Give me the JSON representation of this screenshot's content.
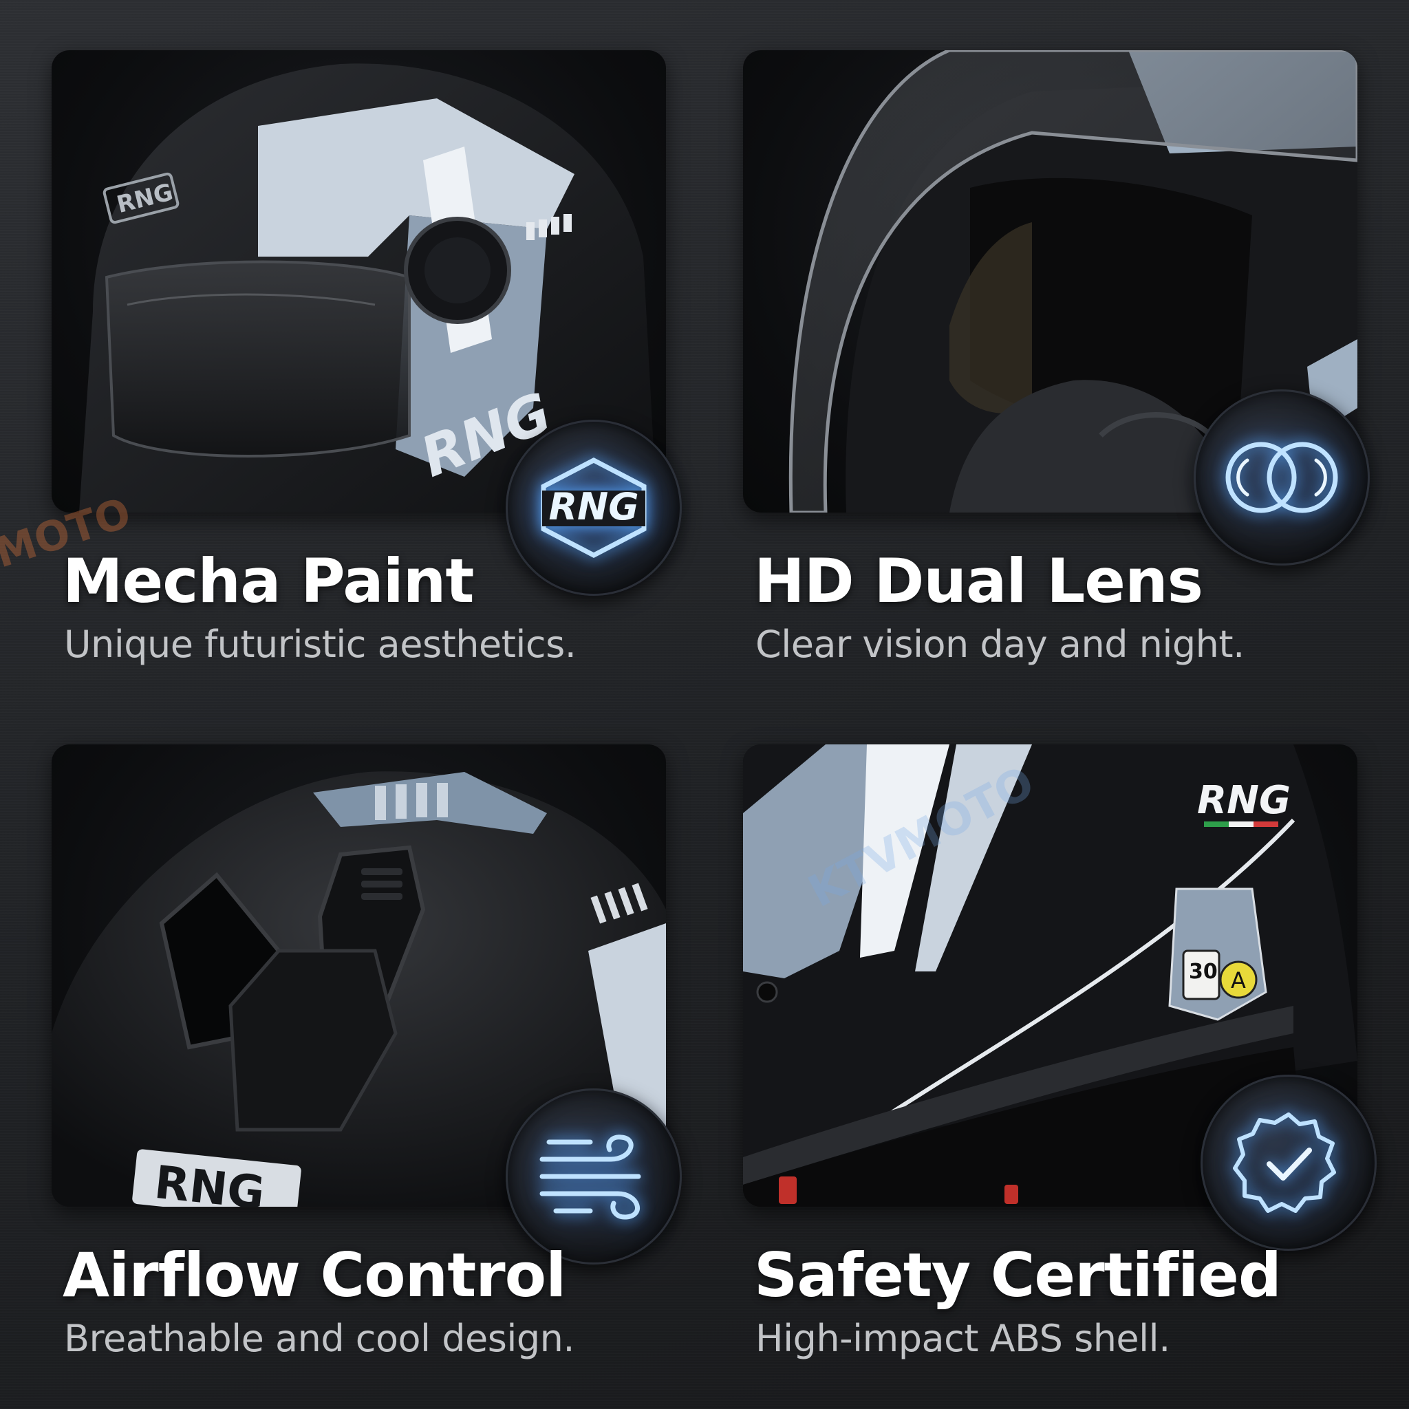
{
  "features": [
    {
      "title": "Mecha Paint",
      "subtitle": "Unique futuristic aesthetics.",
      "badge_icon": "rng-logo-icon",
      "badge_text": "RNG"
    },
    {
      "title": "HD Dual Lens",
      "subtitle": "Clear vision day and night.",
      "badge_icon": "dual-lens-icon"
    },
    {
      "title": "Airflow Control",
      "subtitle": "Breathable and cool design.",
      "badge_icon": "wind-icon"
    },
    {
      "title": "Safety Certified",
      "subtitle": "High-impact ABS shell.",
      "badge_icon": "certified-check-icon"
    }
  ],
  "helmet_labels": {
    "brand": "RNG",
    "cert_number": "30",
    "cert_grade": "A"
  },
  "watermark": {
    "text": "KTVMOTO",
    "partial_text": "MOTO"
  },
  "colors": {
    "glow_blue": "#5fb4ff",
    "accent_grey_blue": "#8fa0b3",
    "background": "#232528",
    "title": "#ffffff",
    "subtitle": "#c2c4c7"
  }
}
